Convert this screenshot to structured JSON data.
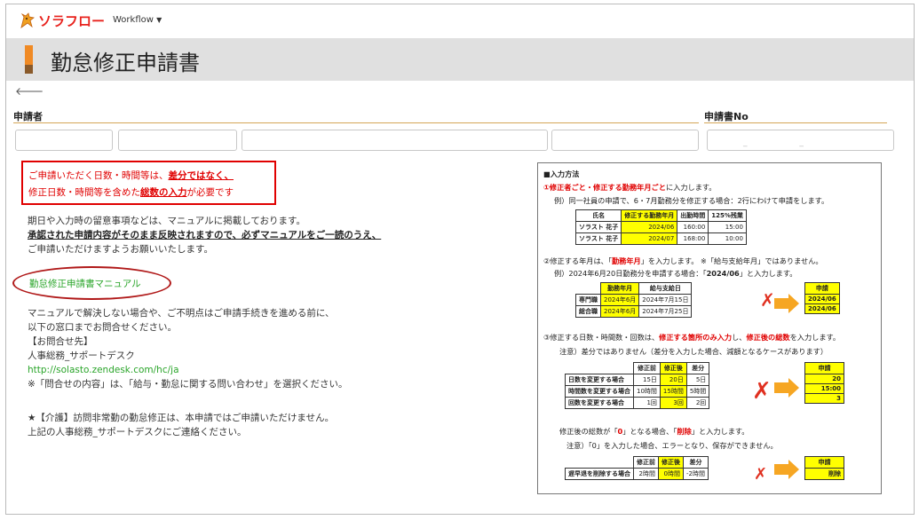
{
  "app": {
    "logo_text": "ソラフロー",
    "menu_label": "Workflow",
    "menu_icon": "caret-down-icon"
  },
  "page": {
    "title": "勤怠修正申請書"
  },
  "form": {
    "applicant_label": "申請者",
    "request_no_label": "申請書No",
    "request_no_value": "_ _"
  },
  "notice": {
    "line1_pre": "ご申請いただく日数・時間等は、",
    "line1_bold": "差分ではなく、",
    "line2_pre": "修正日数・時間等を含めた",
    "line2_bold": "総数の入力",
    "line2_post": "が必要です"
  },
  "guide": {
    "line1": "期日や入力時の留意事項などは、マニュアルに掲載しております。",
    "line2": "承認された申請内容がそのまま反映されますので、必ずマニュアルをご一読のうえ、",
    "line3": "ご申請いただけますようお願いいたします。"
  },
  "manual_link": "勤怠修正申請書マニュアル",
  "contact": {
    "line1": "マニュアルで解決しない場合や、ご不明点はご申請手続きを進める前に、",
    "line2": "以下の窓口までお問合せください。",
    "line3": "【お問合せ先】",
    "line4": "人事総務_サポートデスク",
    "url": "http://solasto.zendesk.com/hc/ja",
    "line6": "※「問合せの内容」は、「給与・勤怠に関する問い合わせ」を選択ください。"
  },
  "care": {
    "line1": "★【介護】訪問非常勤の勤怠修正は、本申請ではご申請いただけません。",
    "line2": "上記の人事総務_サポートデスクにご連絡ください。"
  },
  "instructions": {
    "heading": "■入力方法",
    "s1_red": "①修正者ごと・修正する勤務年月ごと",
    "s1_post": "に入力します。",
    "s1_ex": "例）同一社員の申請で、6・7月勤務分を修正する場合：2行にわけて申請をします。",
    "t1_headers": [
      "氏名",
      "修正する勤務年月",
      "出勤時間",
      "125%残業"
    ],
    "t1_rows": [
      [
        "ソラスト 花子",
        "2024/06",
        "160:00",
        "15:00"
      ],
      [
        "ソラスト 花子",
        "2024/07",
        "168:00",
        "10:00"
      ]
    ],
    "s2_pre": "②修正する年月は、「",
    "s2_red": "勤務年月",
    "s2_post": "」を入力します。 ※「給与支給年月」ではありません。",
    "s2_ex_pre": "例）2024年6月20日勤務分を申請する場合：「",
    "s2_ex_bold": "2024/06",
    "s2_ex_post": "」と入力します。",
    "t2_headers": [
      "",
      "勤務年月",
      "給与支給日"
    ],
    "t2_rows": [
      [
        "専門職",
        "2024年6月",
        "2024年7月15日"
      ],
      [
        "総合職",
        "2024年6月",
        "2024年7月25日"
      ]
    ],
    "t2r_header": "申請",
    "t2r_values": [
      "2024/06",
      "2024/06"
    ],
    "s3_pre": "③修正する日数・時間数・回数は、",
    "s3_red1": "修正する箇所のみ入力",
    "s3_mid": "し、",
    "s3_red2": "修正後の総数",
    "s3_post": "を入力します。",
    "s3_note": "注意）差分ではありません（差分を入力した場合、減額となるケースがあります）",
    "t3_headers": [
      "",
      "修正前",
      "修正後",
      "差分"
    ],
    "t3_rows": [
      [
        "日数を変更する場合",
        "15日",
        "20日",
        "5日"
      ],
      [
        "時間数を変更する場合",
        "10時間",
        "15時間",
        "5時間"
      ],
      [
        "回数を変更する場合",
        "1回",
        "3回",
        "2回"
      ]
    ],
    "t3r_header": "申請",
    "t3r_values": [
      "20",
      "15:00",
      "3"
    ],
    "s4_pre": "修正後の総数が「",
    "s4_red1": "0",
    "s4_mid": "」となる場合、「",
    "s4_red2": "削除",
    "s4_post": "」と入力します。",
    "s4_note": "注意）「0」を入力した場合、エラーとなり、保存ができません。",
    "t4_headers": [
      "",
      "修正前",
      "修正後",
      "差分"
    ],
    "t4_rows": [
      [
        "遅早退を削除する場合",
        "2時間",
        "0時間",
        "-2時間"
      ]
    ],
    "t4r_header": "申請",
    "t4r_values": [
      "削除"
    ]
  }
}
